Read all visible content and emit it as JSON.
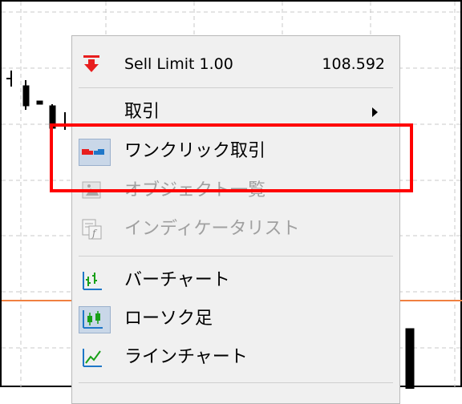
{
  "menu": {
    "sell_limit_label": "Sell Limit 1.00",
    "sell_limit_price": "108.592",
    "trade_label": "取引",
    "one_click_label": "ワンクリック取引",
    "object_list_label": "オブジェクト一覧",
    "indicator_list_label": "インディケータリスト",
    "bar_chart_label": "バーチャート",
    "candle_label": "ローソク足",
    "line_chart_label": "ラインチャート"
  },
  "colors": {
    "sell_arrow": "#e81e1e",
    "highlight": "#ff0000",
    "chart_icon": "#1f77c8",
    "candle_icon_green": "#18a018",
    "price_line": "#f08040"
  },
  "icons": {
    "sell_limit": "red-down-arrow-icon",
    "one_click": "one-click-trading-icon",
    "objects": "object-list-icon",
    "indicators": "indicator-list-icon",
    "bar_chart": "bar-chart-icon",
    "candles": "candlestick-icon",
    "line_chart": "line-chart-icon"
  }
}
